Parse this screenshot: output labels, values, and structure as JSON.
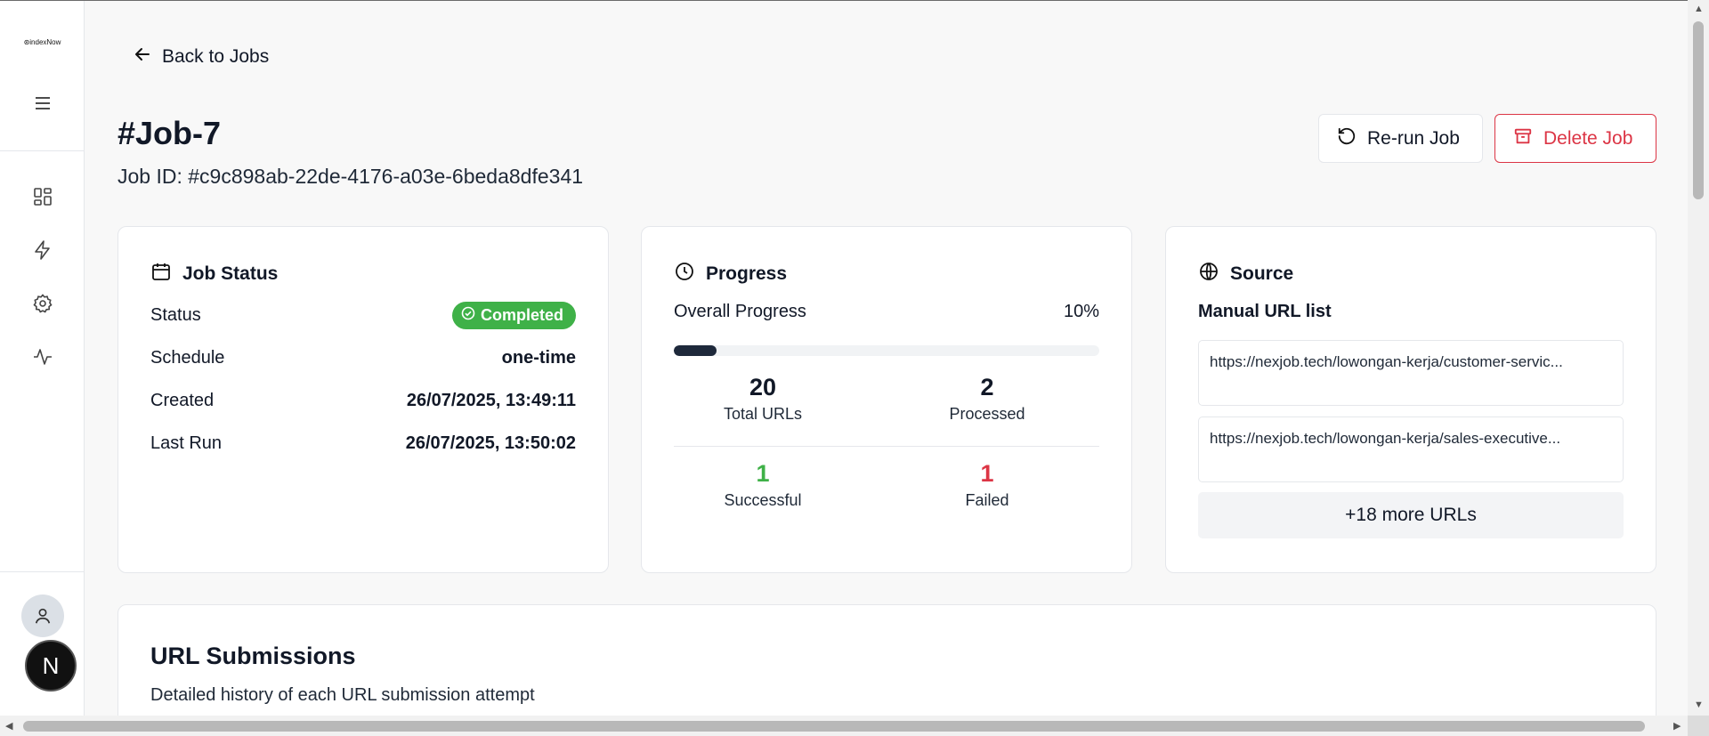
{
  "app": {
    "logo_text": "⊛indexNow"
  },
  "nav": {
    "back_label": "Back to Jobs"
  },
  "header": {
    "title": "#Job-7",
    "job_id": "Job ID: #c9c898ab-22de-4176-a03e-6beda8dfe341",
    "rerun_label": "Re-run Job",
    "delete_label": "Delete Job"
  },
  "job_status": {
    "heading": "Job Status",
    "status_label": "Status",
    "status_value": "Completed",
    "schedule_label": "Schedule",
    "schedule_value": "one-time",
    "created_label": "Created",
    "created_value": "26/07/2025, 13:49:11",
    "last_run_label": "Last Run",
    "last_run_value": "26/07/2025, 13:50:02"
  },
  "progress": {
    "heading": "Progress",
    "overall_label": "Overall Progress",
    "overall_value": "10%",
    "fraction": 0.1,
    "total": "20",
    "total_label": "Total URLs",
    "processed": "2",
    "processed_label": "Processed",
    "successful": "1",
    "successful_label": "Successful",
    "failed": "1",
    "failed_label": "Failed"
  },
  "source": {
    "heading": "Source",
    "subheading": "Manual URL list",
    "urls": [
      "https://nexjob.tech/lowongan-kerja/customer-servic...",
      "https://nexjob.tech/lowongan-kerja/sales-executive..."
    ],
    "more_label": "+18 more URLs"
  },
  "submissions": {
    "title": "URL Submissions",
    "description": "Detailed history of each URL submission attempt"
  },
  "colors": {
    "success": "#3fb148",
    "danger": "#dc3545",
    "progress_fill": "#1e293b"
  }
}
